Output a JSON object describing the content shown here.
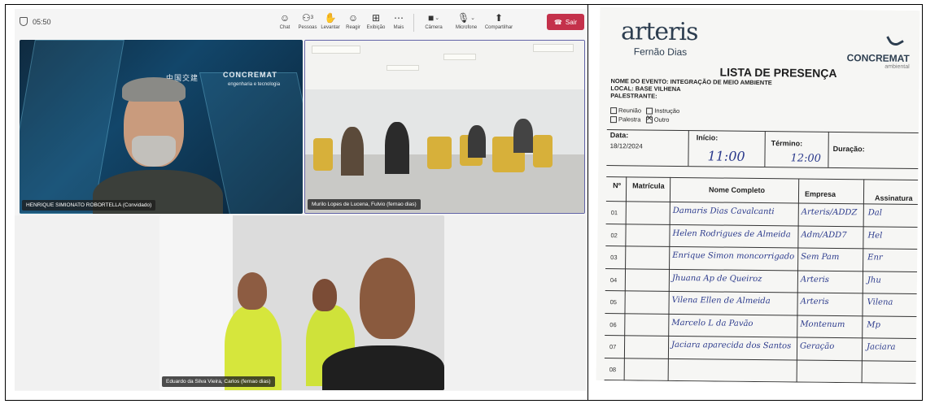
{
  "meeting": {
    "timer": "05:50",
    "toolbar": [
      {
        "label": "Chat",
        "icon": "chat-icon",
        "glyph": "☺"
      },
      {
        "label": "Pessoas",
        "icon": "people-icon",
        "glyph": "⚇",
        "badge": "3"
      },
      {
        "label": "Levantar",
        "icon": "raise-hand-icon",
        "glyph": "✋"
      },
      {
        "label": "Reagir",
        "icon": "react-icon",
        "glyph": "☺"
      },
      {
        "label": "Exibição",
        "icon": "view-icon",
        "glyph": "⊞"
      },
      {
        "label": "Mais",
        "icon": "more-icon",
        "glyph": "⋯"
      }
    ],
    "camera_label": "Câmera",
    "mic_label": "Microfone",
    "share_label": "Compartilhar",
    "leave_label": "Sair",
    "leave_color": "#c4314b",
    "tiles": [
      {
        "name": "HENRIQUE SIMIONATO ROBORTELLA (Convidado)"
      },
      {
        "name": "Murilo Lopes de Lucena, Fulvio (fernao dias)"
      },
      {
        "name": "Eduardo da Silva Vieira, Carlos (fernao dias)"
      }
    ],
    "bg_logo_text": "CONCREMAT",
    "bg_logo_sub": "engenharia e tecnologia",
    "bg_cn_text": "中国交建"
  },
  "sheet": {
    "brand": "arteris",
    "brand_sub": "Fernão Dias",
    "partner": "CONCREMAT",
    "partner_sub": "ambiental",
    "title": "LISTA DE PRESENÇA",
    "event_label": "NOME DO EVENTO:",
    "event_value": "INTEGRAÇÃO DE MEIO AMBIENTE",
    "local_label": "LOCAL:",
    "local_value": "BASE VILHENA",
    "speaker_label": "PALESTRANTE:",
    "types": [
      {
        "label": "Reunião",
        "checked": false
      },
      {
        "label": "Instrução",
        "checked": false
      },
      {
        "label": "Palestra",
        "checked": false
      },
      {
        "label": "Outro",
        "checked": true
      }
    ],
    "date_label": "Data:",
    "date_value": "18/12/2024",
    "start_label": "Início:",
    "start_value": "11:00",
    "end_label": "Término:",
    "end_value": "12:00",
    "duration_label": "Duração:",
    "columns": [
      "Nº",
      "Matrícula",
      "Nome Completo",
      "Empresa",
      "Assinatura"
    ],
    "rows": [
      {
        "n": "01",
        "name": "Damaris Dias Cavalcanti",
        "company": "Arteris/ADDZ",
        "sign": "Dal"
      },
      {
        "n": "02",
        "name": "Helen Rodrigues de Almeida",
        "company": "Adm/ADD7",
        "sign": "Hel"
      },
      {
        "n": "03",
        "name": "Enrique Simon moncorrigado",
        "company": "Sem Pam",
        "sign": "Enr"
      },
      {
        "n": "04",
        "name": "Jhuana Ap de Queiroz",
        "company": "Arteris",
        "sign": "Jhu"
      },
      {
        "n": "05",
        "name": "Vilena Ellen de Almeida",
        "company": "Arteris",
        "sign": "Vilena"
      },
      {
        "n": "06",
        "name": "Marcelo L da Pavão",
        "company": "Montenum",
        "sign": "Mp"
      },
      {
        "n": "07",
        "name": "Jaciara aparecida dos Santos",
        "company": "Geração",
        "sign": "Jaciara"
      },
      {
        "n": "08",
        "name": "",
        "company": "",
        "sign": ""
      }
    ]
  }
}
